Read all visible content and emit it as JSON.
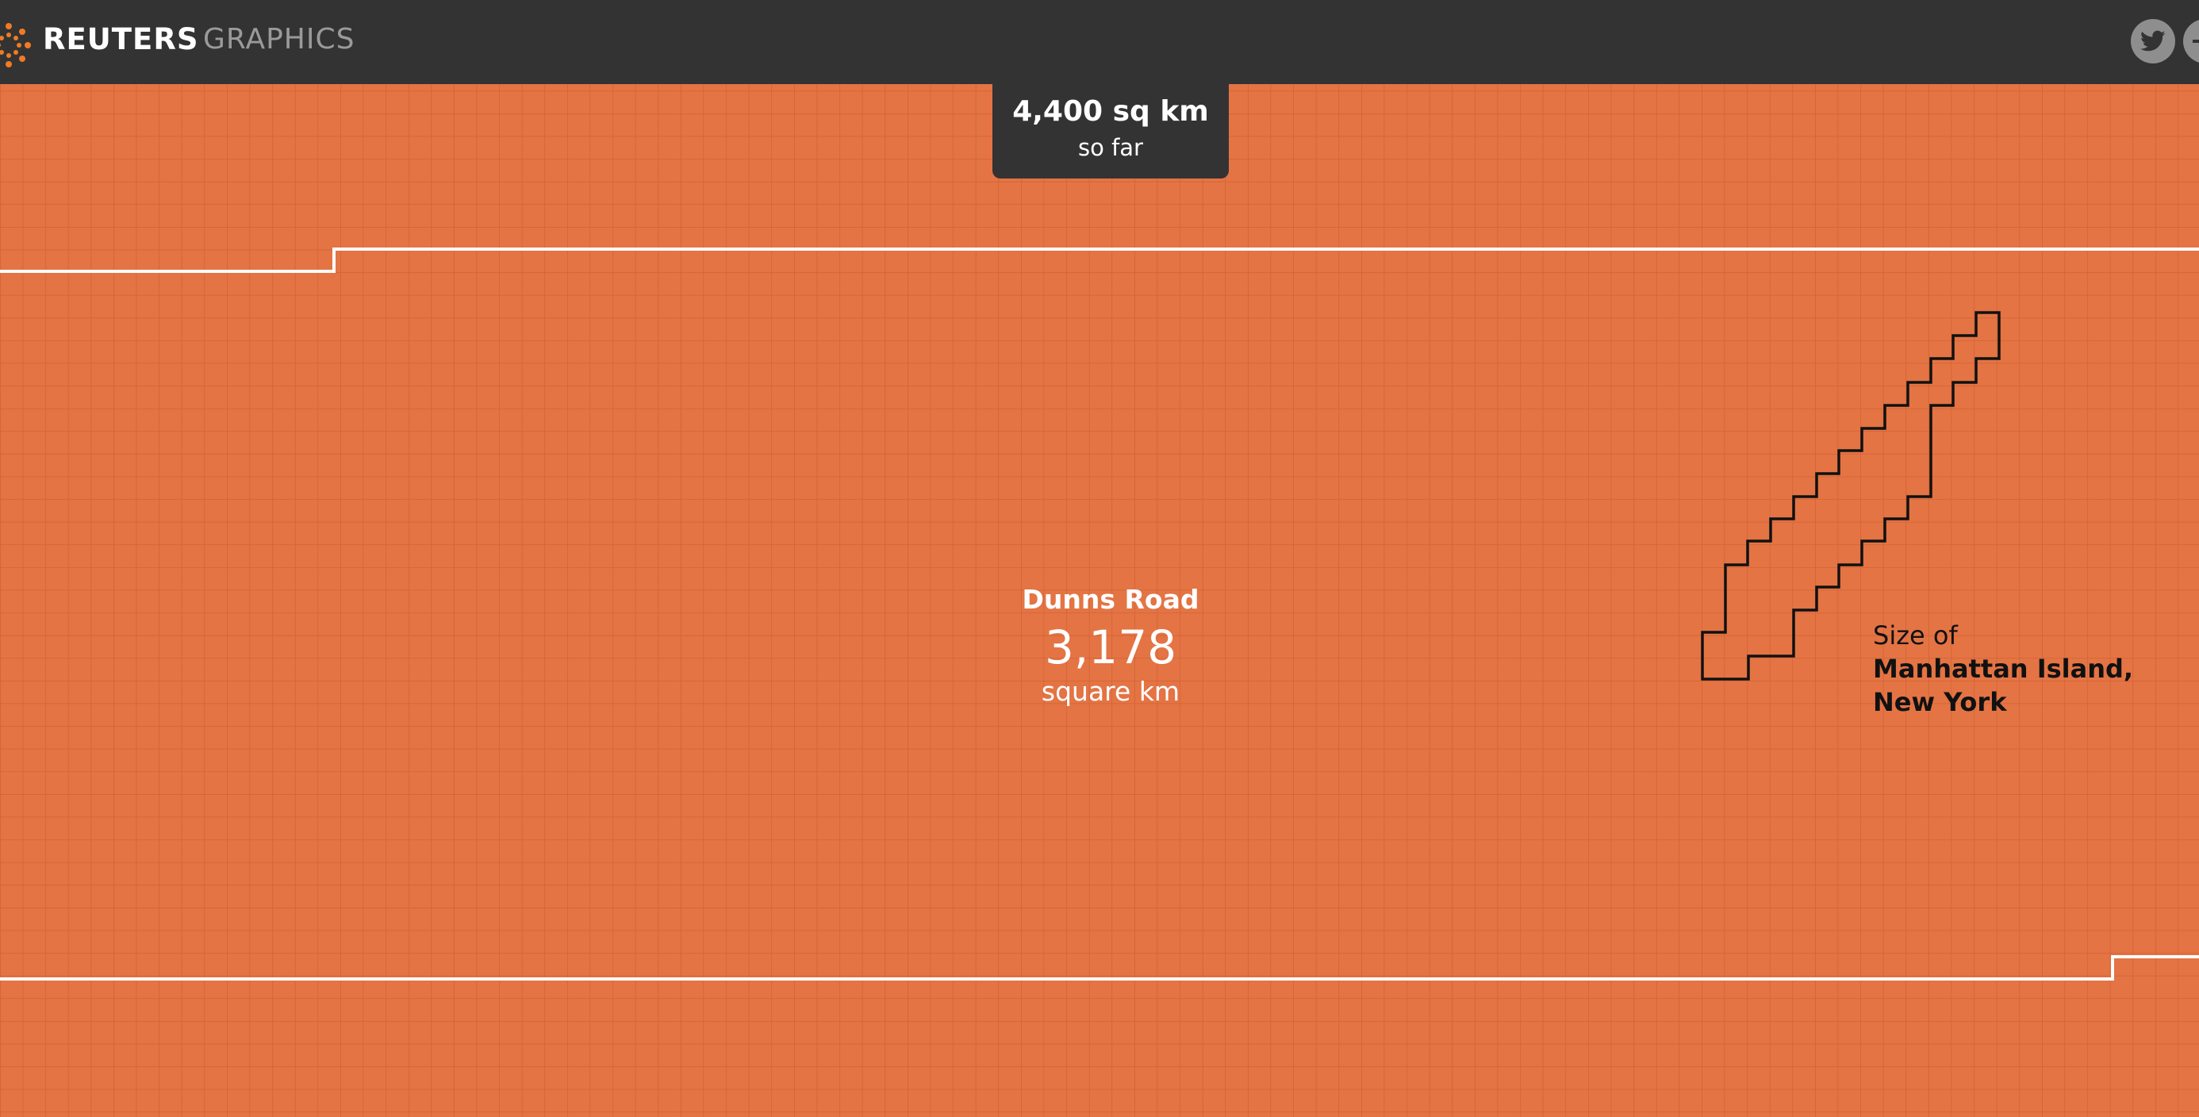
{
  "header": {
    "brand": "REUTERS",
    "section": "GRAPHICS",
    "share_icons": [
      "twitter-icon",
      "share-icon"
    ]
  },
  "counter": {
    "value": "4,400 sq km",
    "caption": "so far"
  },
  "region": {
    "name": "Dunns Road",
    "value": "3,178",
    "unit": "square km"
  },
  "comparison": {
    "prefix": "Size of",
    "name": "Manhattan Island, New York"
  },
  "colors": {
    "background": "#e47444",
    "grid_line": "#c9552a",
    "header": "#333333",
    "boundary_line": "#ffffff",
    "outline": "#111111",
    "brand_accent": "#f07b24"
  }
}
